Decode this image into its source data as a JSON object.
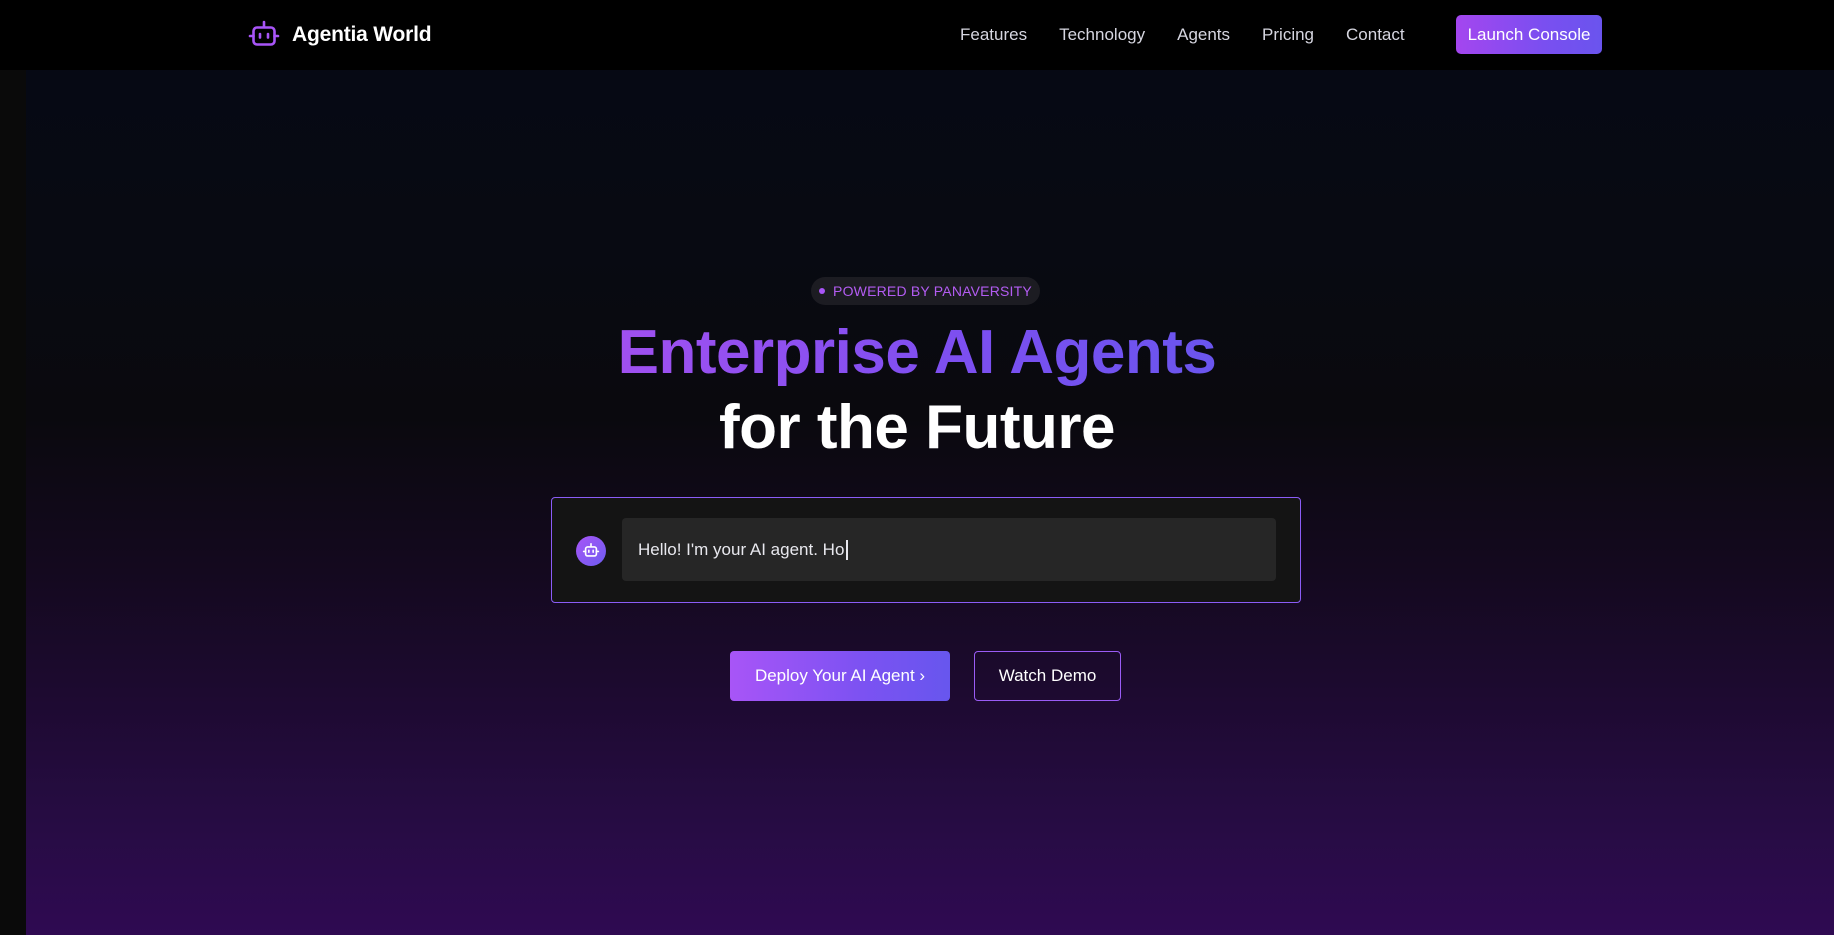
{
  "nav": {
    "brand_name": "Agentia World",
    "brand_icon": "robot-icon",
    "links": [
      "Features",
      "Technology",
      "Agents",
      "Pricing",
      "Contact"
    ],
    "cta_label": "Launch Console"
  },
  "hero": {
    "badge_text": "POWERED BY PANAVERSITY",
    "headline_line1": "Enterprise AI Agents",
    "headline_line2": "for the Future",
    "chat": {
      "avatar_icon": "robot-icon",
      "typed_text": "Hello! I'm your AI agent. Ho"
    },
    "primary_cta": "Deploy Your AI Agent ›",
    "secondary_cta": "Watch Demo"
  },
  "colors": {
    "accent": "#a855f7",
    "accent_secondary": "#6a55ee",
    "background": "#000000",
    "text": "#ffffff"
  }
}
